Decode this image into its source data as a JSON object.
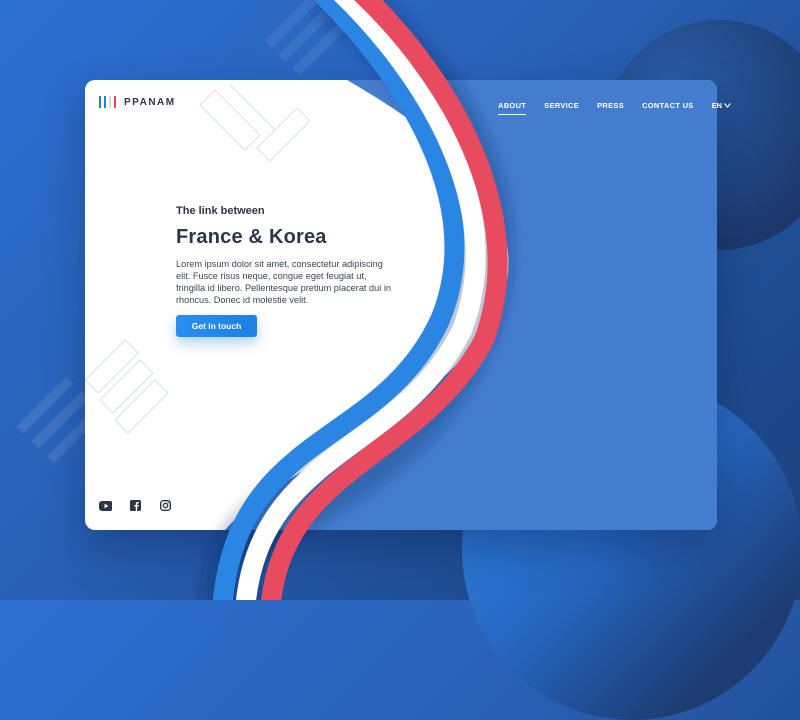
{
  "brand": {
    "name": "PPANAM",
    "colors": {
      "blue": "#1f7fe4",
      "red": "#e84a5f",
      "white": "#ffffff"
    }
  },
  "nav": {
    "items": [
      {
        "label": "ABOUT",
        "active": true
      },
      {
        "label": "SERVICE",
        "active": false
      },
      {
        "label": "PRESS",
        "active": false
      },
      {
        "label": "CONTACT US",
        "active": false
      }
    ],
    "language": "EN"
  },
  "hero": {
    "subtitle": "The link between",
    "title": "France & Korea",
    "body": "Lorem ipsum dolor sit amet, consectetur adipiscing elit. Fusce risus neque, congue eget feugiat ut, fringilla id libero. Pellentesque pretium placerat dui in rhoncus. Donec id molestie velit.",
    "cta_label": "Get in touch"
  },
  "social": {
    "icons": [
      "youtube-icon",
      "facebook-icon",
      "instagram-icon"
    ]
  }
}
